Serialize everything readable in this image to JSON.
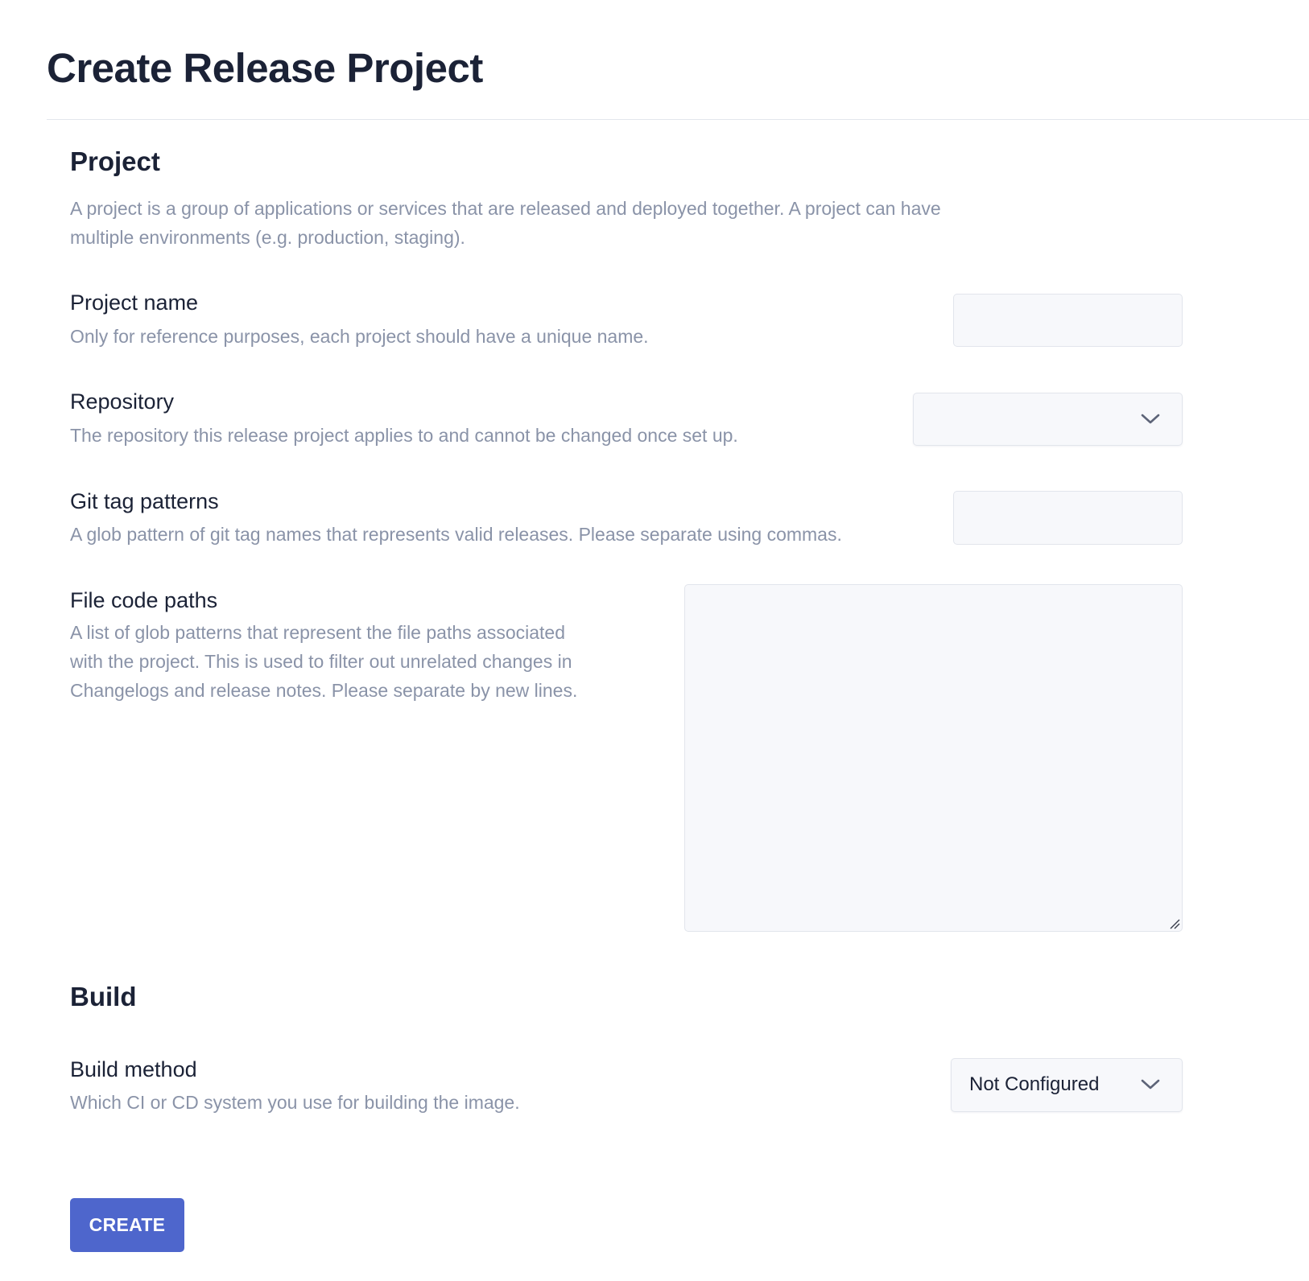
{
  "page": {
    "title": "Create Release Project"
  },
  "project_section": {
    "heading": "Project",
    "description": "A project is a group of applications or services that are released and deployed together. A project can have multiple environments (e.g. production, staging)."
  },
  "fields": {
    "project_name": {
      "label": "Project name",
      "help": "Only for reference purposes, each project should have a unique name.",
      "value": ""
    },
    "repository": {
      "label": "Repository",
      "help": "The repository this release project applies to and cannot be changed once set up.",
      "selected": ""
    },
    "git_tag_patterns": {
      "label": "Git tag patterns",
      "help": "A glob pattern of git tag names that represents valid releases. Please separate using commas.",
      "value": ""
    },
    "file_code_paths": {
      "label": "File code paths",
      "help": "A list of glob patterns that represent the file paths associated with the project. This is used to filter out unrelated changes in Changelogs and release notes. Please separate by new lines.",
      "value": ""
    }
  },
  "build_section": {
    "heading": "Build",
    "build_method": {
      "label": "Build method",
      "help": "Which CI or CD system you use for building the image.",
      "selected": "Not Configured"
    }
  },
  "actions": {
    "create_label": "CREATE"
  },
  "icons": {
    "select_chevron": "chevron-down-icon",
    "textarea_resize": "resize-grip-icon"
  },
  "colors": {
    "primary_button": "#4e66cc",
    "title_text": "#1b2236",
    "muted_text": "#8a93a8",
    "input_background": "#f7f8fb",
    "input_border": "#e2e5ec"
  }
}
